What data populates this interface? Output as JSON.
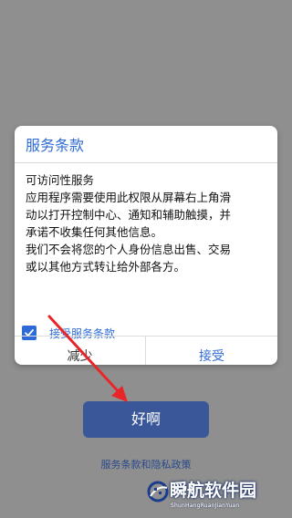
{
  "dialog": {
    "title": "服务条款",
    "body_lines": [
      "可访问性服务",
      "应用程序需要使用此权限从屏幕右上角滑",
      "动以打开控制中心、通知和辅助触摸，并",
      "承诺不收集任何其他信息。",
      "我们不会将您的个人身份信息出售、交易",
      "或以其他方式转让给外部各方。"
    ],
    "consent_label": "接受服务条款",
    "consent_checked": true,
    "buttons": {
      "reduce": "减少",
      "accept": "接受"
    }
  },
  "main_button_label": "好啊",
  "privacy_link": "服务条款和隐私政策",
  "watermark": {
    "title": "瞬航软件园",
    "subtitle": "ShunHangRuanJianYuan"
  },
  "colors": {
    "accent": "#2f6bd6",
    "main_button": "#3a579a",
    "annotation_arrow": "#e8262a",
    "backdrop": "#8f8f8f"
  },
  "icons": [
    "checkmark-icon",
    "arrow-annotation-icon",
    "watermark-logo-icon"
  ]
}
